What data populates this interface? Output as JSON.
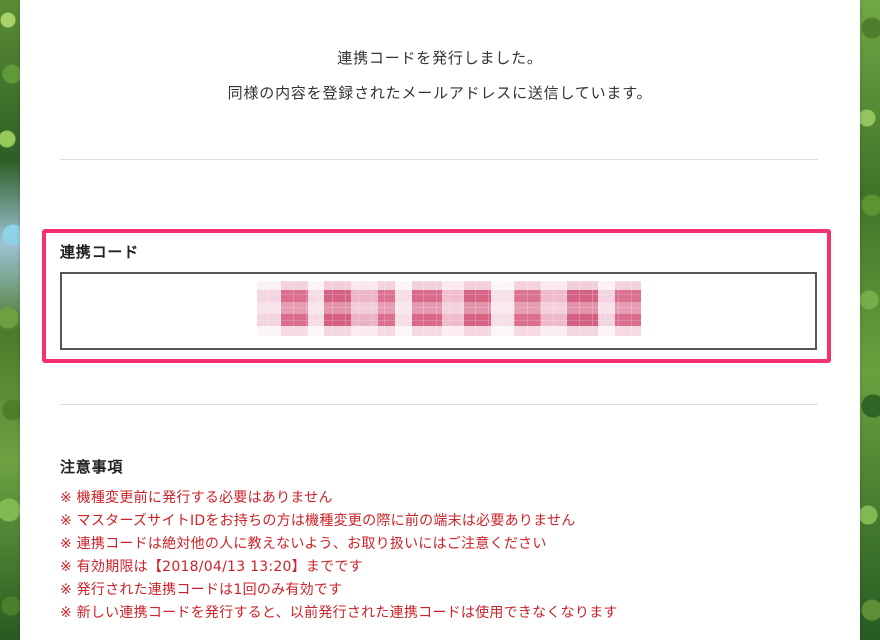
{
  "message": {
    "lines": [
      "連携コードを発行しました。",
      "同様の内容を登録されたメールアドレスに送信しています。"
    ]
  },
  "code_section": {
    "label": "連携コード",
    "code_value": ""
  },
  "notes": {
    "title": "注意事項",
    "items": [
      "※ 機種変更前に発行する必要はありません",
      "※ マスターズサイトIDをお持ちの方は機種変更の際に前の端末は必要ありません",
      "※ 連携コードは絶対他の人に教えないよう、お取り扱いにはご注意ください",
      "※ 有効期限は【2018/04/13 13:20】までです",
      "※ 発行された連携コードは1回のみ有効です",
      "※ 新しい連携コードを発行すると、以前発行された連携コードは使用できなくなります"
    ]
  },
  "colors": {
    "highlight_border": "#f2336e",
    "notice_text": "#cc2229",
    "panel_background": "#ffffff"
  },
  "icons": {
    "notice_marker": "reference-mark"
  }
}
